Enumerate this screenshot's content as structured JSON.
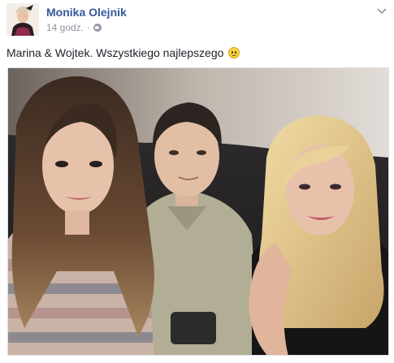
{
  "post": {
    "author": "Monika Olejnik",
    "timestamp": "14 godz.",
    "separator": "·",
    "privacy_icon": "globe-icon",
    "menu_icon": "chevron-down-icon",
    "caption": "Marina & Wojtek. Wszystkiego najlepszego",
    "caption_emoji": "smiley-icon"
  },
  "colors": {
    "author_link": "#365899",
    "meta_text": "#90949c",
    "body_text": "#1d2129"
  }
}
